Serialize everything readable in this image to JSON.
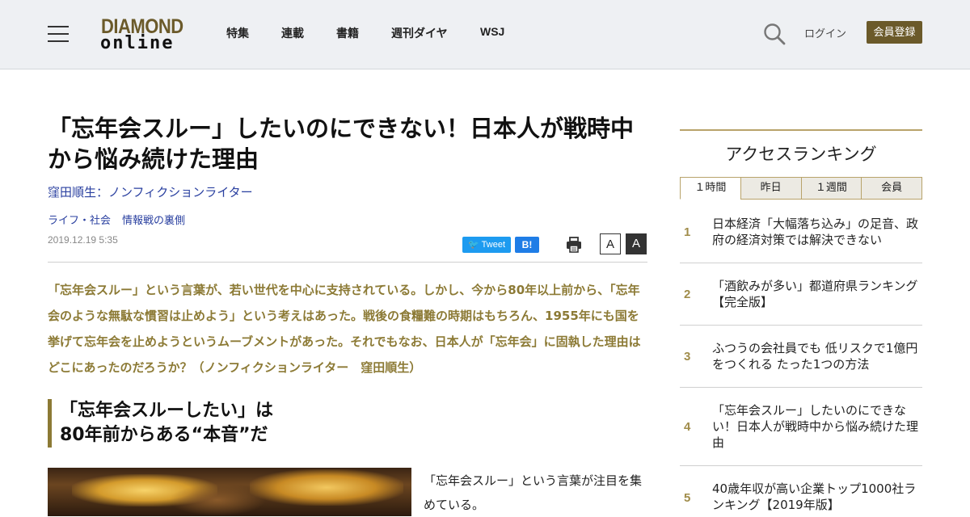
{
  "header": {
    "logo_top": "DIAMOND",
    "logo_bottom": "online",
    "nav": [
      "特集",
      "連載",
      "書籍",
      "週刊ダイヤ",
      "WSJ"
    ],
    "login": "ログイン",
    "register": "会員登録"
  },
  "article": {
    "title": "「忘年会スルー」したいのにできない！日本人が戦時中から悩み続けた理由",
    "author": "窪田順生：ノンフィクションライター",
    "tags": [
      "ライフ・社会",
      "情報戦の裏側"
    ],
    "date": "2019.12.19 5:35",
    "share": {
      "tweet": "Tweet",
      "hatena": "B!"
    },
    "font_small": "A",
    "font_large": "A",
    "lead": "「忘年会スルー」という言葉が、若い世代を中心に支持されている。しかし、今から80年以上前から、「忘年会のような無駄な慣習は止めよう」という考えはあった。戦後の食糧難の時期はもちろん、1955年にも国を挙げて忘年会を止めようというムーブメントがあった。それでもなお、日本人が「忘年会」に固執した理由はどこにあったのだろうか？（ノンフィクションライター　窪田順生）",
    "subhead_line1": "「忘年会スルーしたい」は",
    "subhead_line2": "80年前からある“本音”だ",
    "body": "「忘年会スルー」という言葉が注目を集めている。"
  },
  "ranking": {
    "title": "アクセスランキング",
    "tabs": [
      "１時間",
      "昨日",
      "１週間",
      "会員"
    ],
    "active_tab": "１時間",
    "items": [
      {
        "rank": "1",
        "text": "日本経済「大幅落ち込み」の足音、政府の経済対策では解決できない"
      },
      {
        "rank": "2",
        "text": "「酒飲みが多い」都道府県ランキング【完全版】"
      },
      {
        "rank": "3",
        "text": "ふつうの会社員でも 低リスクで1億円をつくれる たった1つの方法"
      },
      {
        "rank": "4",
        "text": "「忘年会スルー」したいのにできない！日本人が戦時中から悩み続けた理由"
      },
      {
        "rank": "5",
        "text": "40歳年収が高い企業トップ1000社ランキング【2019年版】"
      }
    ]
  },
  "colors": {
    "brand": "#6b5a2a",
    "lead": "#8c7a35",
    "link": "#2a40a0"
  }
}
